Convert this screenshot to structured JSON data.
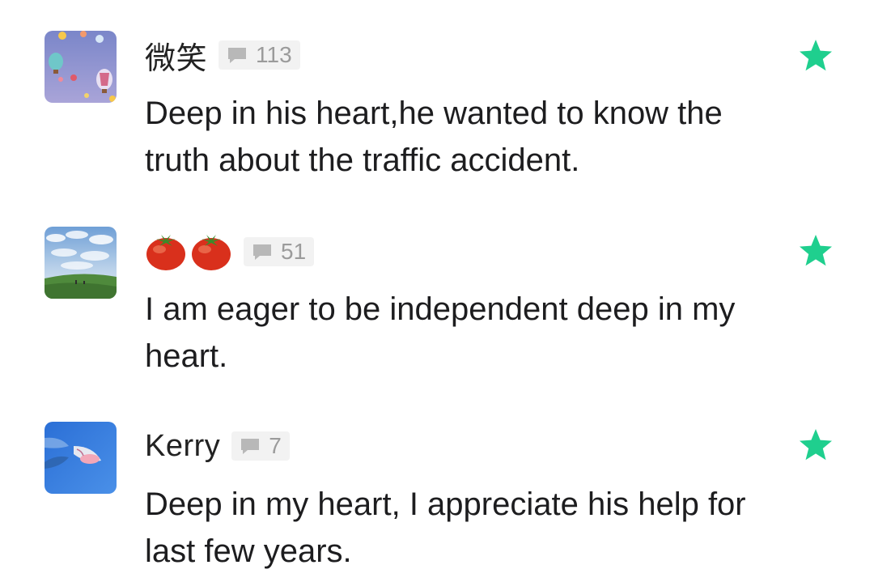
{
  "comments": [
    {
      "username": "微笑",
      "reply_count": "113",
      "text": "Deep in his heart,he wanted to know the truth about the traffic accident.",
      "avatar": "hot-air-balloons"
    },
    {
      "username": "",
      "username_emoji": [
        "tomato-emoji",
        "tomato-emoji"
      ],
      "reply_count": "51",
      "text": "I am eager to be independent deep in my heart.",
      "avatar": "sky-meadow"
    },
    {
      "username": "Kerry",
      "reply_count": "7",
      "text": "Deep in my heart, I appreciate his help for last few years.",
      "avatar": "blue-sky-flower"
    }
  ],
  "colors": {
    "star": "#1fcf8e",
    "badge_bg": "#f2f2f2",
    "badge_text": "#9b9b9b"
  }
}
